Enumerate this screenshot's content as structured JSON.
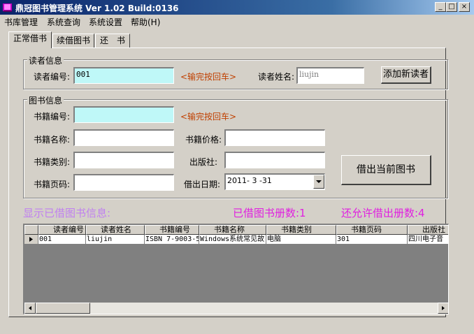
{
  "window": {
    "title": "鼎冠图书管理系统 Ver 1.02 Build:0136",
    "minimize": "_",
    "maximize": "□",
    "close": "×"
  },
  "menu": [
    "书库管理",
    "系统查询",
    "系统设置",
    "帮助(H)"
  ],
  "tabs": [
    "正常借书",
    "续借图书",
    "还　书"
  ],
  "reader": {
    "group_label": "读者信息",
    "id_label": "读者编号:",
    "id_value": "001",
    "hint": "<输完按回车>",
    "name_label": "读者姓名:",
    "name_value": "liujin",
    "add_button": "添加新读者"
  },
  "book": {
    "group_label": "图书信息",
    "id_label": "书籍编号:",
    "id_value": "",
    "hint": "<输完按回车>",
    "name_label": "书籍名称:",
    "name_value": "",
    "price_label": "书籍价格:",
    "price_value": "",
    "category_label": "书籍类别:",
    "category_value": "",
    "publisher_label": "出版社:",
    "publisher_value": "",
    "pages_label": "书籍页码:",
    "pages_value": "",
    "date_label": "借出日期:",
    "date_value": "2011- 3 -31",
    "borrow_button": "借出当前图书"
  },
  "status": {
    "show_info": "显示已借图书信息:",
    "borrowed": "已借图书册数:1",
    "remaining": "还允许借出册数:4"
  },
  "grid": {
    "columns": [
      "读者编号",
      "读者姓名",
      "书籍编号",
      "书籍名称",
      "书籍类别",
      "书籍页码",
      "出版社"
    ],
    "rows": [
      [
        "001",
        "liujin",
        "ISBN 7-9003-5",
        "Windows系统常见故",
        "电脑",
        "301",
        "四川电子音"
      ]
    ]
  },
  "colors": {
    "status_text": "#e020e0",
    "status_left": "#c080f0",
    "hint_text": "#c04000",
    "input_highlight": "#bff8f8"
  }
}
